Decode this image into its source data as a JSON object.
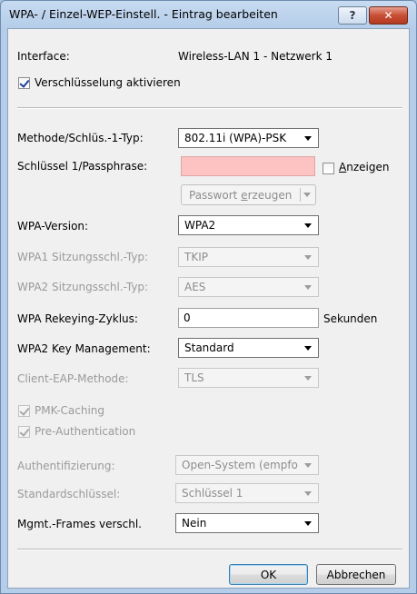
{
  "window": {
    "title": "WPA- / Einzel-WEP-Einstell. - Eintrag bearbeiten",
    "help_label": "?",
    "close_label": "✕"
  },
  "interface": {
    "label": "Interface:",
    "value": "Wireless-LAN 1 - Netzwerk 1"
  },
  "encryption_enable": {
    "label": "Verschlüsselung aktivieren",
    "checked": true
  },
  "method": {
    "label": "Methode/Schlüs.-1-Typ:",
    "value": "802.11i (WPA)-PSK"
  },
  "passphrase": {
    "label": "Schlüssel 1/Passphrase:",
    "value": "",
    "show_label": "Anzeigen",
    "show_checked": false,
    "generate_label": "Passwort erzeugen"
  },
  "wpa_version": {
    "label": "WPA-Version:",
    "value": "WPA2"
  },
  "wpa1_session": {
    "label": "WPA1 Sitzungsschl.-Typ:",
    "value": "TKIP"
  },
  "wpa2_session": {
    "label": "WPA2 Sitzungsschl.-Typ:",
    "value": "AES"
  },
  "rekeying": {
    "label": "WPA Rekeying-Zyklus:",
    "value": "0",
    "unit": "Sekunden"
  },
  "key_mgmt": {
    "label": "WPA2 Key Management:",
    "value": "Standard"
  },
  "eap_method": {
    "label": "Client-EAP-Methode:",
    "value": "TLS"
  },
  "pmk_caching": {
    "label": "PMK-Caching",
    "checked": true
  },
  "pre_auth": {
    "label": "Pre-Authentication",
    "checked": true
  },
  "authentication": {
    "label": "Authentifizierung:",
    "value": "Open-System (empfo"
  },
  "default_key": {
    "label": "Standardschlüssel:",
    "value": "Schlüssel 1"
  },
  "mgmt_frames": {
    "label": "Mgmt.-Frames verschl.",
    "value": "Nein"
  },
  "buttons": {
    "ok": "OK",
    "cancel": "Abbrechen"
  },
  "colors": {
    "passphrase_bg": "#fdc3c3",
    "close_button": "#c74f35"
  }
}
